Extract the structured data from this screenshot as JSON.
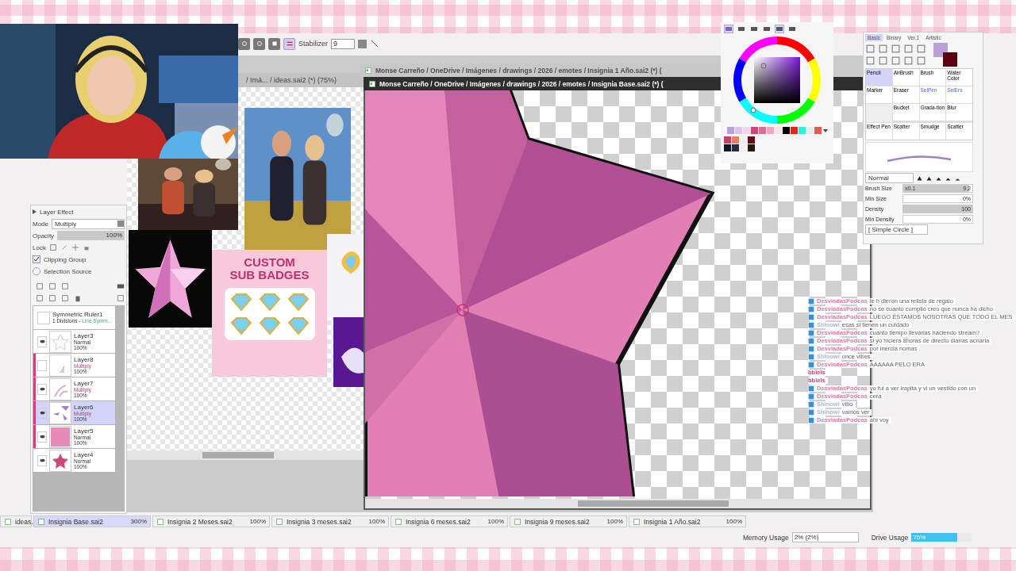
{
  "toolbar": {
    "stabilizer_label": "Stabilizer",
    "stabilizer_value": "9"
  },
  "reference_board": {
    "title": "/ Imá... / ideas.sai2 (*) (75%)",
    "badge_card": {
      "title": "CUSTOM",
      "subtitle": "SUB BADGES"
    }
  },
  "documents": [
    {
      "title": "Monse Carreño / OneDrive / Imágenes / drawings / 2026 / emotes / Insignia 1 Año.sai2 (*) (",
      "selected": false
    },
    {
      "title": "Monse Carreño / OneDrive / Imágenes / drawings / 2026 / emotes / Insignia Base.sai2 (*) (",
      "selected": true
    }
  ],
  "layer_effect": {
    "title": "Layer Effect",
    "mode_label": "Mode",
    "mode": "Multiply",
    "opacity_label": "Opacity",
    "opacity": "100%",
    "level": 1,
    "lock_label": "Lock",
    "options": [
      {
        "label": "Clipping Group",
        "checked": true
      },
      {
        "label": "Selection Source",
        "checked": false
      }
    ]
  },
  "layers": [
    {
      "kind": "ruler",
      "name": "Symmetric Ruler1",
      "detail": "1 Divisions - ",
      "detail_extra": "Line Symm..."
    },
    {
      "kind": "layer",
      "name": "Layer3",
      "mode": "Normal",
      "opacity": "100%",
      "visible": true,
      "clipped": false,
      "selected": false
    },
    {
      "kind": "layer",
      "name": "Layer8",
      "mode": "Multiply",
      "opacity": "100%",
      "visible": false,
      "clipped": true,
      "selected": false
    },
    {
      "kind": "layer",
      "name": "Layer7",
      "mode": "Multiply",
      "opacity": "100%",
      "visible": true,
      "clipped": true,
      "selected": false
    },
    {
      "kind": "layer",
      "name": "Layer6",
      "mode": "Multiply",
      "opacity": "100%",
      "visible": true,
      "clipped": true,
      "selected": true
    },
    {
      "kind": "layer",
      "name": "Layer5",
      "mode": "Normal",
      "opacity": "100%",
      "visible": true,
      "clipped": true,
      "selected": false
    },
    {
      "kind": "layer",
      "name": "Layer4",
      "mode": "Normal",
      "opacity": "100%",
      "visible": true,
      "clipped": false,
      "selected": false
    }
  ],
  "color_panel": {
    "modes": [
      {
        "selected": true
      },
      {
        "selected": false
      },
      {
        "selected": false
      },
      {
        "selected": false
      },
      {
        "selected": true
      },
      {
        "selected": false
      }
    ],
    "swatches": [
      {
        "color": "#b9a0d8"
      },
      {
        "color": "#dcc4e8"
      },
      {
        "color": "#f0d8ec"
      },
      {
        "color": "#c8487a"
      },
      {
        "color": "#d87090"
      },
      {
        "color": "#f0a8c0"
      },
      {
        "color": "#f8e0e8"
      },
      {
        "color": "#000000"
      },
      {
        "color": "#e02818"
      },
      {
        "color": "#30f0e0"
      },
      {
        "color": "#e8e8e8"
      },
      {
        "color": "#d86050"
      }
    ],
    "custom_swatches": [
      {
        "color": "#b84868"
      },
      {
        "color": "#e88060"
      },
      {
        "color": "#f8f0f0"
      },
      {
        "color": "#600818"
      },
      {
        "color": "#101828"
      },
      {
        "color": "#282848"
      },
      {
        "color": "#f8f0f0"
      },
      {
        "color": "#281810"
      }
    ]
  },
  "tool_panel": {
    "tabs": [
      {
        "label": "Basic",
        "selected": true
      },
      {
        "label": "Binary",
        "selected": false
      },
      {
        "label": "Ver.1",
        "selected": false
      },
      {
        "label": "Artistic",
        "selected": false
      }
    ],
    "tools": [
      {
        "label": "Pencil",
        "selected": true,
        "kind": "normal"
      },
      {
        "label": "AirBrush",
        "selected": false,
        "kind": "normal"
      },
      {
        "label": "Brush",
        "selected": false,
        "kind": "normal"
      },
      {
        "label": "Water Color",
        "selected": false,
        "kind": "normal"
      },
      {
        "label": "Marker",
        "selected": false,
        "kind": "normal"
      },
      {
        "label": "Eraser",
        "selected": false,
        "kind": "normal"
      },
      {
        "label": "SelPen",
        "selected": false,
        "kind": "selection"
      },
      {
        "label": "SelErs",
        "selected": false,
        "kind": "selection"
      },
      {
        "kind": "empty"
      },
      {
        "label": "Bucket",
        "selected": false,
        "kind": "normal"
      },
      {
        "label": "Grada-tion",
        "selected": false,
        "kind": "normal"
      },
      {
        "label": "Blur",
        "selected": false,
        "kind": "normal"
      },
      {
        "label": "Effect Pen",
        "selected": false,
        "kind": "normal"
      },
      {
        "label": "Scatter",
        "selected": false,
        "kind": "normal"
      },
      {
        "label": "Smudge",
        "selected": false,
        "kind": "normal"
      },
      {
        "label": "Scatter",
        "selected": false,
        "kind": "normal"
      }
    ],
    "blend_mode": "Normal",
    "settings": [
      {
        "label": "Brush Size",
        "prefix": "x0.1",
        "value": "9.2",
        "level": 0.95
      },
      {
        "label": "Min Size",
        "value": "0%"
      },
      {
        "label": "Density",
        "value": "100",
        "level": 1
      },
      {
        "label": "Min Density",
        "value": "0%"
      }
    ],
    "brush_shape": "[ Simple Circle ]"
  },
  "chat": [
    {
      "author": "DesviadasPodcas",
      "color": "#e878a8",
      "message": "le h dieron una relista de regalo"
    },
    {
      "author": "DesviadasPodcas",
      "color": "#e878a8",
      "message": "no se cuanto cumplio creo que nunca ha dicho"
    },
    {
      "author": "DesviadasPodcas",
      "color": "#e878a8",
      "message": "LUEGO ESTAMOS NOSOTRAS QUE TODO EL MES"
    },
    {
      "author": "Shinowi",
      "color": "#a8b8e0",
      "message": "esas si tienen un cuidado"
    },
    {
      "author": "DesviadasPodcas",
      "color": "#e878a8",
      "message": "cuanto tiempo llevarias haciendo stream?"
    },
    {
      "author": "DesviadasPodcas",
      "color": "#e878a8",
      "message": "si yo hiciera 8horas de directo diarias acnaria"
    },
    {
      "author": "DesviadasPodcas",
      "color": "#e878a8",
      "message": "por inercia nomas"
    },
    {
      "author": "Shinowi",
      "color": "#a8b8e0",
      "message": "once vibes"
    },
    {
      "author": "DesviadasPodcas",
      "color": "#e878a8",
      "message": "AAAAAA PELO ERA"
    },
    {
      "author": "bbiels",
      "color": "#c04880"
    },
    {
      "author": "bbiels",
      "color": "#c04880"
    },
    {
      "author": "DesviadasPodcas",
      "color": "#e878a8",
      "message": "yo fui a ver irapita y vi un vestido con un"
    },
    {
      "author": "DesviadasPodcas",
      "color": "#e878a8",
      "message": "cera"
    },
    {
      "author": "Shinowi",
      "color": "#a8b8e0",
      "message": "vibo"
    },
    {
      "author": "Shinowi",
      "color": "#a8b8e0",
      "message": "vamos ver"
    },
    {
      "author": "DesviadasPodcas",
      "color": "#e878a8",
      "message": "ahi voy"
    }
  ],
  "file_tabs": [
    {
      "label": "ideas.",
      "selected": false
    },
    {
      "label": "Insignia Base.sai2",
      "zoom": "300%",
      "selected": true
    },
    {
      "label": "Insignia 2 Meses.sai2",
      "zoom": "100%",
      "selected": false
    },
    {
      "label": "Insignia 3 meses.sai2",
      "zoom": "100%",
      "selected": false
    },
    {
      "label": "Insignia 6 meses.sai2",
      "zoom": "100%",
      "selected": false
    },
    {
      "label": "Insignia 9 meses.sai2",
      "zoom": "100%",
      "selected": false
    },
    {
      "label": "Insignia 1 Año.sai2",
      "zoom": "100%",
      "selected": false
    }
  ],
  "status_bar": {
    "memory": {
      "label": "Memory Usage",
      "value": "2% (2%)"
    },
    "drive": {
      "label": "Drive Usage",
      "value": "76%",
      "level": 0.76
    }
  }
}
